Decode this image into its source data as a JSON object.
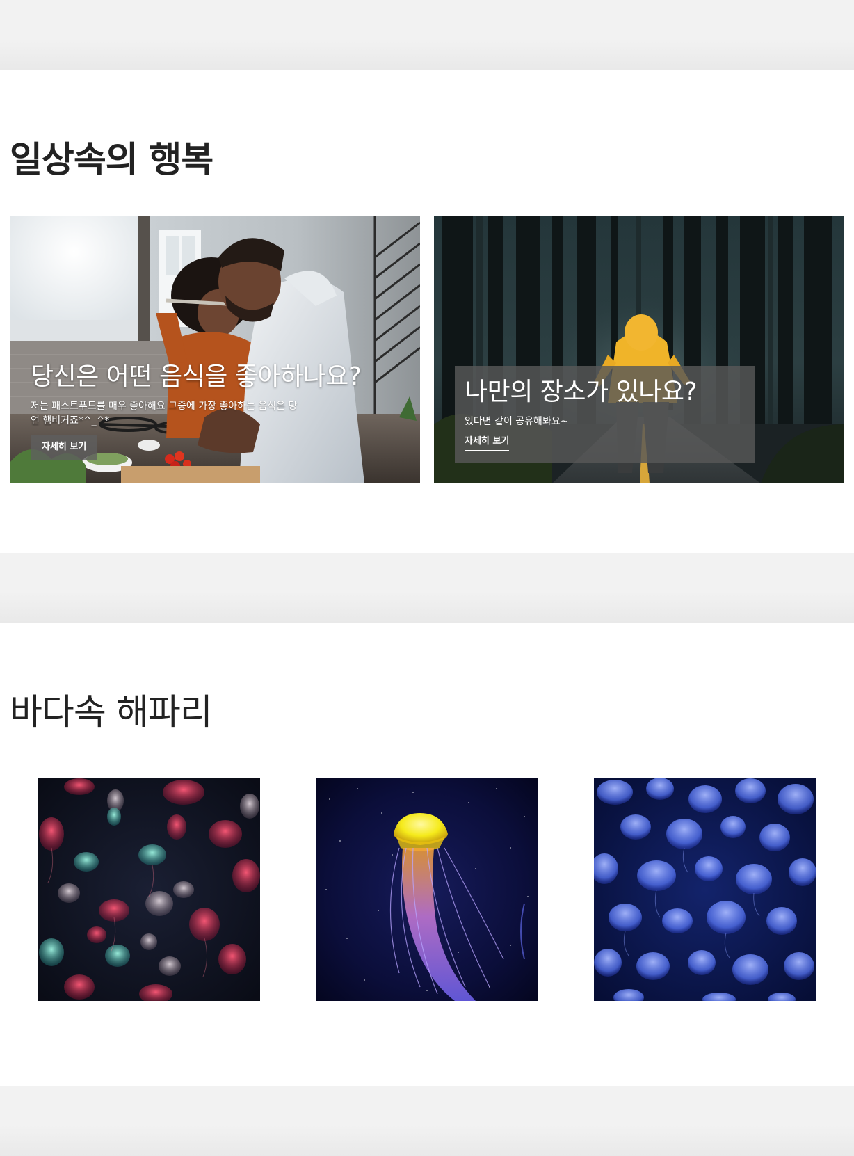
{
  "happiness_section": {
    "title": "일상속의 행복",
    "cards": [
      {
        "image": "couple-cooking-in-kitchen-photo",
        "title": "당신은 어떤 음식을 좋아하나요?",
        "description": "저는 패스트푸드를 매우 좋아해요 그중에 가장 좋아하는 음식은 당연 햄버거죠*^_^*",
        "button_label": "자세히 보기"
      },
      {
        "image": "person-in-yellow-hoodie-forest-road-photo",
        "title": "나만의 장소가 있나요?",
        "description": "있다면 같이 공유해봐요~",
        "button_label": "자세히 보기"
      }
    ]
  },
  "jellyfish_section": {
    "title": "바다속 해파리",
    "images": [
      "red-and-teal-jellyfish-photo",
      "yellow-jellyfish-photo",
      "blue-jellyfish-swarm-photo"
    ]
  },
  "colors": {
    "page_background": "#f2f2f2",
    "section_background": "#ffffff",
    "title_text": "#222222",
    "overlay_box": "#585858",
    "hoodie_yellow": "#f0b429",
    "jelly_yellow": "#f5ea1a",
    "jelly_blue": "#5b7bff"
  }
}
